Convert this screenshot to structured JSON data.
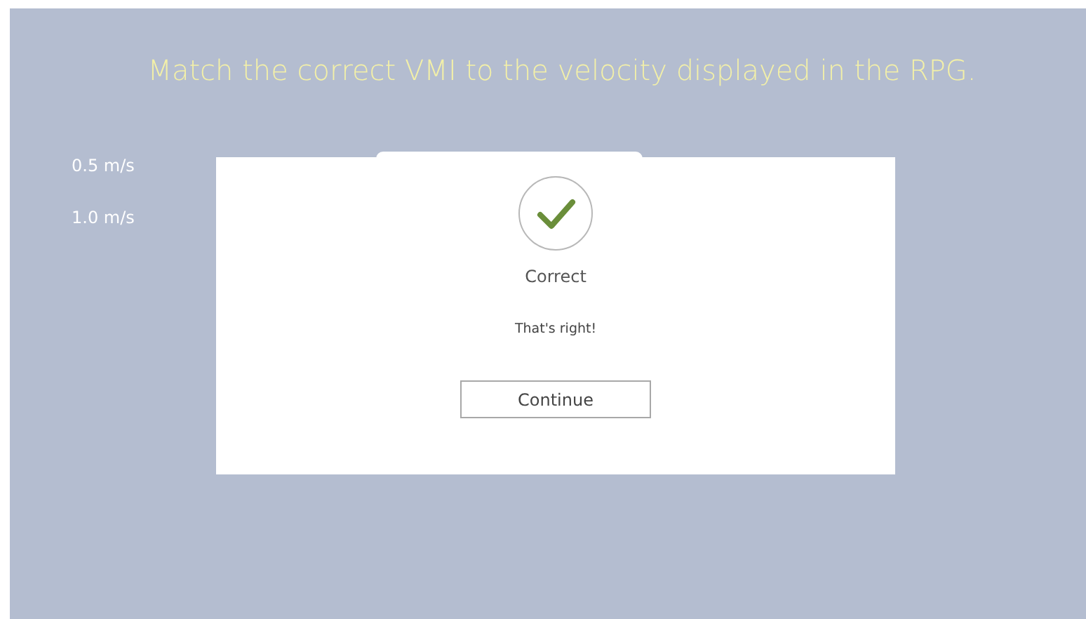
{
  "title": "Match the correct VMI to the velocity displayed in the RPG.",
  "velocities": [
    "0.5 m/s",
    "1.0 m/s"
  ],
  "dialog": {
    "correct": true,
    "heading": "Correct",
    "message": "That's right!",
    "button": "Continue"
  }
}
